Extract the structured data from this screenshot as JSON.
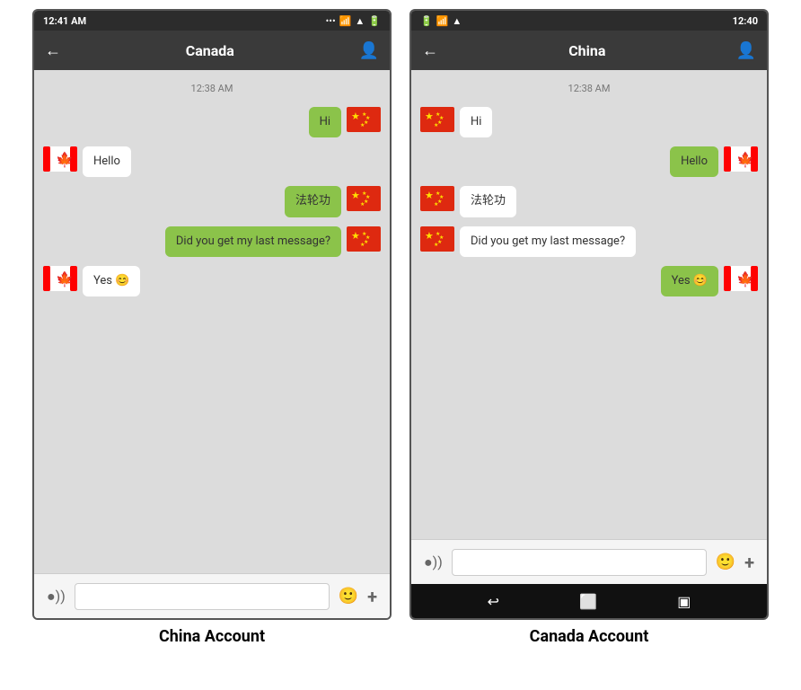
{
  "left_phone": {
    "status_bar": {
      "time": "12:41 AM",
      "icons": "... ● ▲ |||  🔋"
    },
    "nav": {
      "title": "Canada",
      "back_label": "←",
      "profile_label": "👤"
    },
    "chat": {
      "timestamp": "12:38 AM",
      "messages": [
        {
          "id": 1,
          "text": "Hi",
          "type": "sent",
          "flag": "china"
        },
        {
          "id": 2,
          "text": "Hello",
          "type": "received",
          "flag": "canada"
        },
        {
          "id": 3,
          "text": "法轮功",
          "type": "sent",
          "flag": "china"
        },
        {
          "id": 4,
          "text": "Did you get my last message?",
          "type": "sent",
          "flag": "china"
        },
        {
          "id": 5,
          "text": "Yes 😊",
          "type": "received",
          "flag": "canada"
        }
      ]
    },
    "bottom": {
      "voice_icon": "●))",
      "emoji_icon": "🙂",
      "add_icon": "+"
    }
  },
  "right_phone": {
    "status_bar": {
      "time": "12:40",
      "icons": "🔋 📶 ..."
    },
    "nav": {
      "title": "China",
      "back_label": "←",
      "profile_label": "👤"
    },
    "chat": {
      "timestamp": "12:38 AM",
      "messages": [
        {
          "id": 1,
          "text": "Hi",
          "type": "received",
          "flag": "china"
        },
        {
          "id": 2,
          "text": "Hello",
          "type": "sent",
          "flag": "canada"
        },
        {
          "id": 3,
          "text": "法轮功",
          "type": "received",
          "flag": "china"
        },
        {
          "id": 4,
          "text": "Did you get my last message?",
          "type": "received",
          "flag": "china"
        },
        {
          "id": 5,
          "text": "Yes 😊",
          "type": "sent",
          "flag": "canada"
        }
      ]
    },
    "bottom": {
      "voice_icon": "●))",
      "emoji_icon": "🙂",
      "add_icon": "+"
    },
    "android_nav": {
      "back": "↩",
      "home": "⬜",
      "recent": "▣"
    }
  },
  "labels": {
    "left": "China Account",
    "right": "Canada Account"
  }
}
